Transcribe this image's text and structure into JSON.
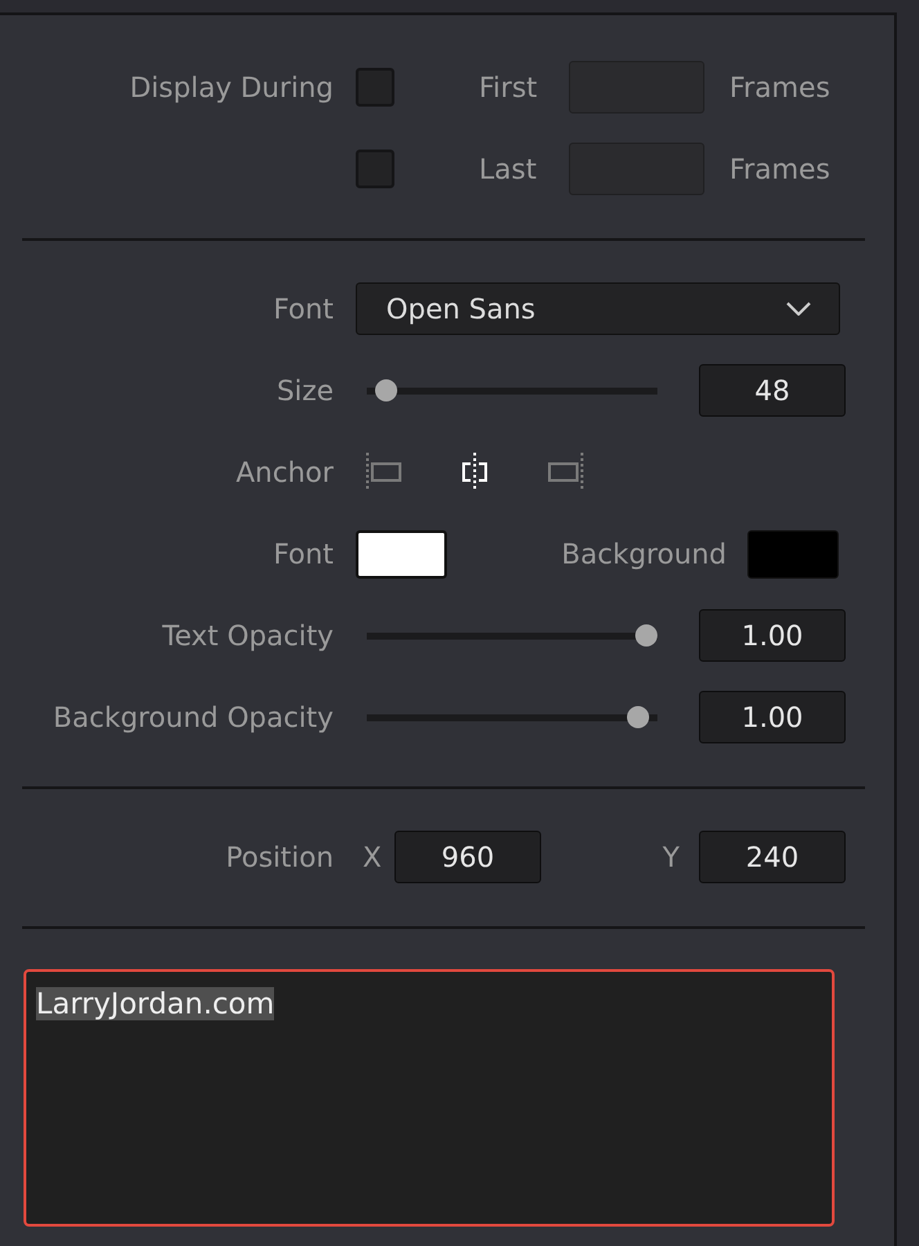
{
  "display_during": {
    "label": "Display During",
    "rows": [
      {
        "checked": false,
        "label": "First",
        "unit": "Frames"
      },
      {
        "checked": false,
        "label": "Last",
        "unit": "Frames"
      }
    ]
  },
  "font": {
    "label": "Font",
    "value": "Open Sans"
  },
  "size": {
    "label": "Size",
    "level": 0.03,
    "value": "48"
  },
  "anchor": {
    "label": "Anchor",
    "options": [
      {
        "kind": "left",
        "selected": false
      },
      {
        "kind": "center",
        "selected": true
      },
      {
        "kind": "right",
        "selected": false
      }
    ]
  },
  "colors": [
    {
      "label": "Font",
      "color": "#ffffff"
    },
    {
      "label": "Background",
      "color": "#000000"
    }
  ],
  "opacity": [
    {
      "label": "Text Opacity",
      "level": 1,
      "value": "1.00"
    },
    {
      "label": "Background Opacity",
      "level": 0.97,
      "value": "1.00"
    }
  ],
  "position": {
    "label": "Position",
    "fields": [
      {
        "axis": "X",
        "value": "960"
      },
      {
        "axis": "Y",
        "value": "240"
      }
    ]
  },
  "text_box": {
    "value": "LarryJordan.com",
    "selected": true
  }
}
